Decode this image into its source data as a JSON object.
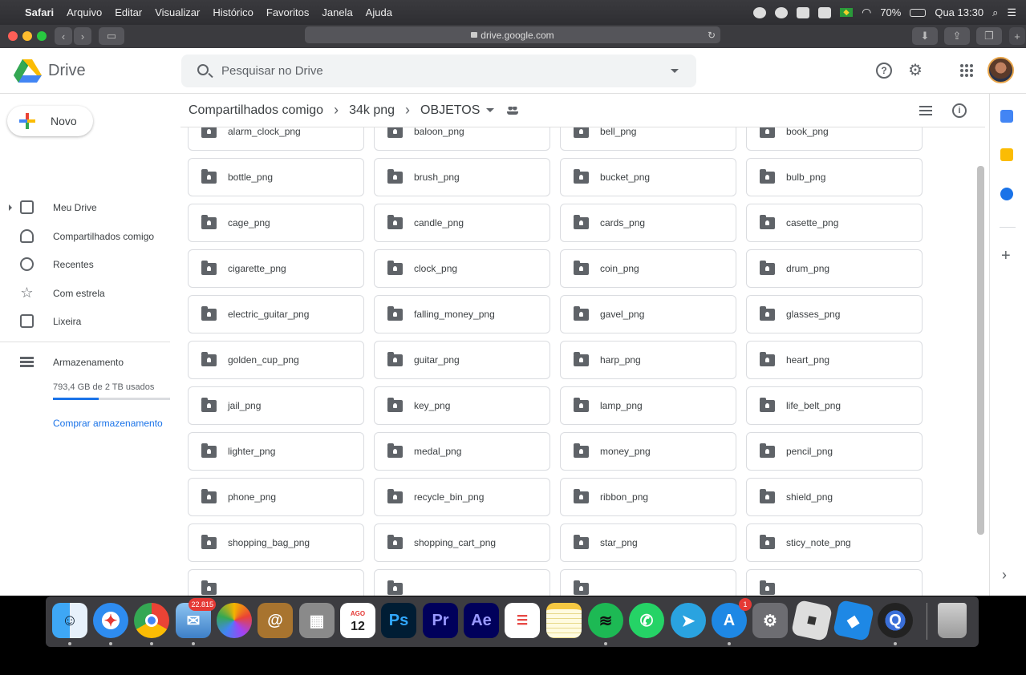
{
  "mac_menu": {
    "app": "Safari",
    "items": [
      "Arquivo",
      "Editar",
      "Visualizar",
      "Histórico",
      "Favoritos",
      "Janela",
      "Ajuda"
    ],
    "battery": "70%",
    "clock": "Qua 13:30"
  },
  "browser": {
    "url": "drive.google.com"
  },
  "drive": {
    "logo_text": "Drive",
    "search_placeholder": "Pesquisar no Drive",
    "new_label": "Novo",
    "nav": [
      "Meu Drive",
      "Compartilhados comigo",
      "Recentes",
      "Com estrela",
      "Lixeira"
    ],
    "storage_label": "Armazenamento",
    "storage_used": "793,4 GB de 2 TB usados",
    "storage_fraction": 0.39,
    "buy_storage": "Comprar armazenamento",
    "breadcrumb": [
      "Compartilhados comigo",
      "34k png",
      "OBJETOS"
    ],
    "folders": [
      "alarm_clock_png",
      "baloon_png",
      "bell_png",
      "book_png",
      "bottle_png",
      "brush_png",
      "bucket_png",
      "bulb_png",
      "cage_png",
      "candle_png",
      "cards_png",
      "casette_png",
      "cigarette_png",
      "clock_png",
      "coin_png",
      "drum_png",
      "electric_guitar_png",
      "falling_money_png",
      "gavel_png",
      "glasses_png",
      "golden_cup_png",
      "guitar_png",
      "harp_png",
      "heart_png",
      "jail_png",
      "key_png",
      "lamp_png",
      "life_belt_png",
      "lighter_png",
      "medal_png",
      "money_png",
      "pencil_png",
      "phone_png",
      "recycle_bin_png",
      "ribbon_png",
      "shield_png",
      "shopping_bag_png",
      "shopping_cart_png",
      "star_png",
      "sticy_note_png"
    ]
  },
  "dock": {
    "apps": [
      "finder",
      "safari",
      "chrome",
      "mail",
      "photos",
      "contacts",
      "calculator",
      "calendar",
      "photoshop",
      "premiere",
      "after-effects",
      "reminders",
      "notes",
      "spotify",
      "whatsapp",
      "telegram",
      "app-store",
      "system-preferences",
      "roblox",
      "roblox-studio",
      "quicktime",
      "trash"
    ],
    "mail_badge": "22.815",
    "appstore_badge": "1",
    "calendar_month": "AGO",
    "calendar_day": "12",
    "ps_label": "Ps",
    "pr_label": "Pr",
    "ae_label": "Ae"
  },
  "colors": {
    "accent": "#1a73e8",
    "drive_blue": "#4285f4",
    "drive_green": "#34a853",
    "drive_yellow": "#fbbc04"
  }
}
